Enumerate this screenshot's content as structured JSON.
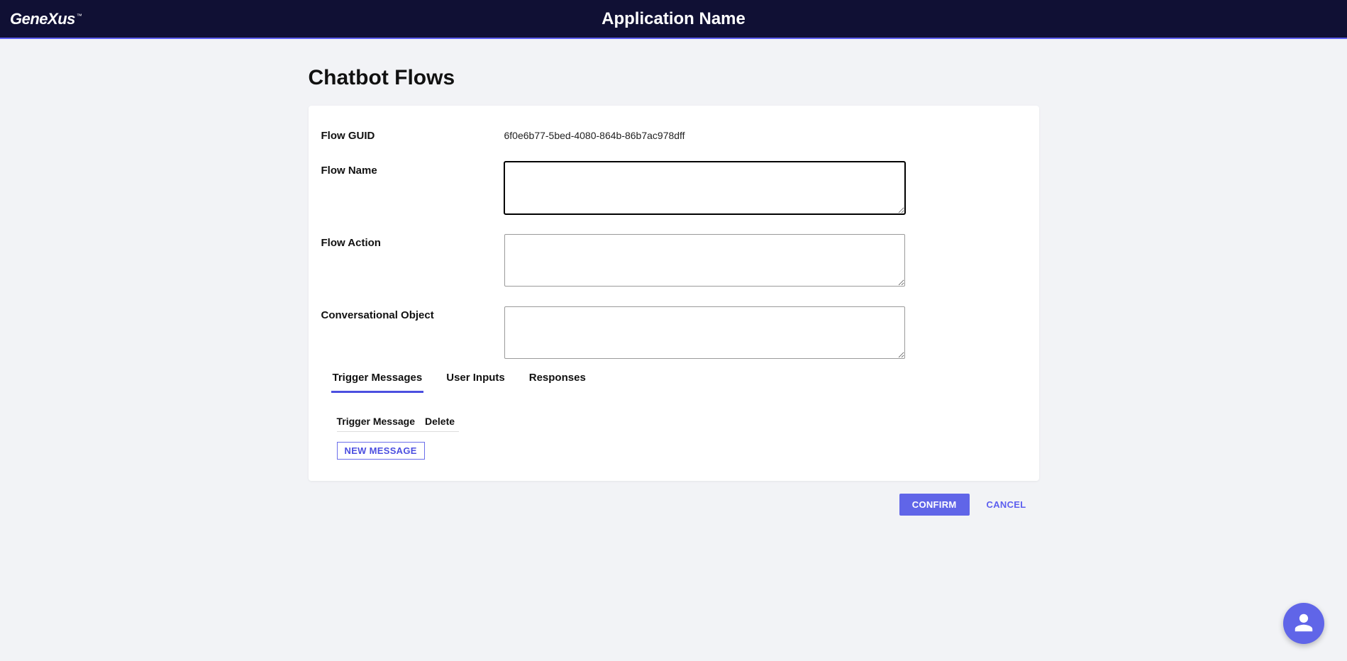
{
  "header": {
    "logo": "GeneXus",
    "tm": "™",
    "app_title": "Application Name"
  },
  "page": {
    "title": "Chatbot Flows"
  },
  "form": {
    "guid_label": "Flow GUID",
    "guid_value": "6f0e6b77-5bed-4080-864b-86b7ac978dff",
    "name_label": "Flow Name",
    "name_value": "",
    "action_label": "Flow Action",
    "action_value": "",
    "convobj_label": "Conversational Object",
    "convobj_value": ""
  },
  "tabs": {
    "items": [
      {
        "label": "Trigger Messages",
        "active": true
      },
      {
        "label": "User Inputs",
        "active": false
      },
      {
        "label": "Responses",
        "active": false
      }
    ]
  },
  "trigger_table": {
    "col_message": "Trigger Message",
    "col_delete": "Delete",
    "new_btn": "NEW MESSAGE"
  },
  "actions": {
    "confirm": "CONFIRM",
    "cancel": "CANCEL"
  }
}
